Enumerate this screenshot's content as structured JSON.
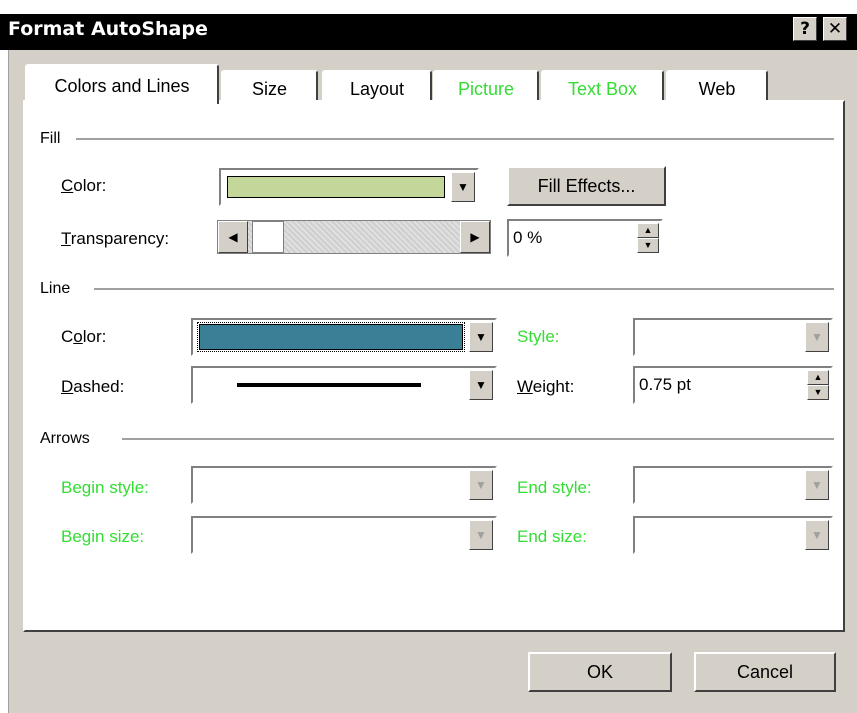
{
  "window": {
    "title": "Format AutoShape",
    "help_glyph": "?",
    "close_glyph": "✕"
  },
  "tabs": [
    {
      "label": "Colors and Lines",
      "active": true,
      "enabled": true
    },
    {
      "label": "Size",
      "active": false,
      "enabled": true
    },
    {
      "label": "Layout",
      "active": false,
      "enabled": true
    },
    {
      "label": "Picture",
      "active": false,
      "enabled": false
    },
    {
      "label": "Text Box",
      "active": false,
      "enabled": false
    },
    {
      "label": "Web",
      "active": false,
      "enabled": true
    }
  ],
  "fill": {
    "section": "Fill",
    "color_label": "olor:",
    "color_accel": "C",
    "color_value": "#c4d79b",
    "fill_effects": "Fill Effects...",
    "transparency_label": "ransparency:",
    "transparency_accel": "T",
    "transparency_value": "0 %",
    "transparency_level": 0
  },
  "line": {
    "section": "Line",
    "color_label_a": "C",
    "color_accel": "o",
    "color_label_b": "lor:",
    "color_value": "#3a7f96",
    "dashed_label": "ashed:",
    "dashed_accel": "D",
    "style_label": "Style:",
    "weight_accel": "W",
    "weight_label": "eight:",
    "weight_value": "0.75 pt"
  },
  "arrows": {
    "section": "Arrows",
    "begin_style": "Begin style:",
    "begin_size": "Begin size:",
    "end_style": "End style:",
    "end_size": "End size:"
  },
  "buttons": {
    "ok": "OK",
    "cancel": "Cancel"
  },
  "colors": {
    "disabled_text": "#33dd33",
    "dialog_face": "#d4d0c8"
  }
}
